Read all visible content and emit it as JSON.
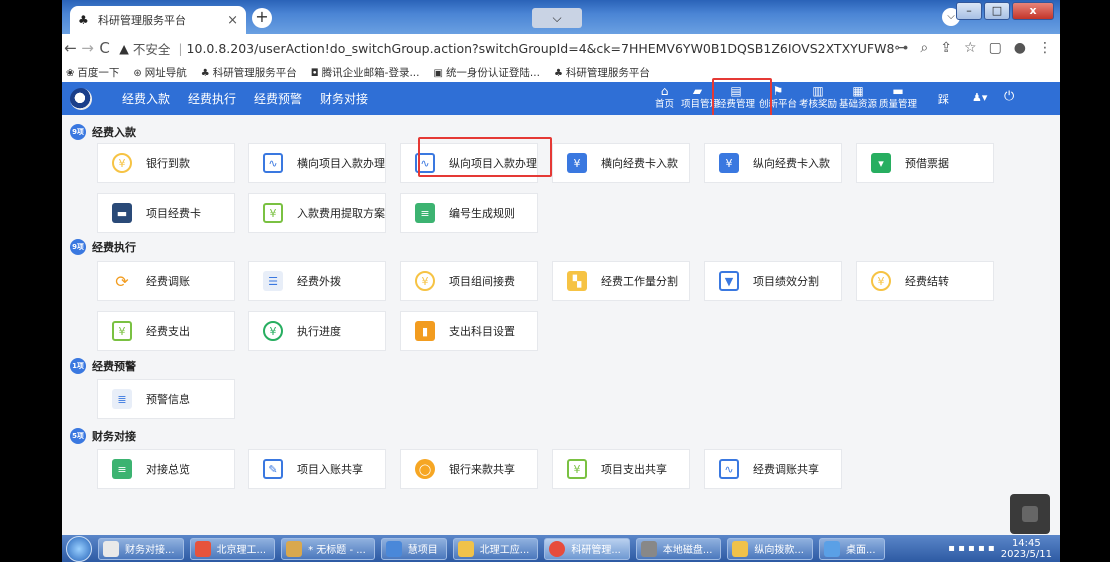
{
  "browser": {
    "tab_title": "科研管理服务平台",
    "tab_close": "×",
    "new_tab": "+",
    "tab_dropdown": "⌵",
    "address": {
      "insecure_label": "不安全",
      "url": "10.0.8.203/userAction!do_switchGroup.action?switchGroupId=4&ck=7HHEMV6YW0B1DQSB1Z6IOVS2XTXYUFW8"
    }
  },
  "bookmarks": [
    "百度一下",
    "网址导航",
    "科研管理服务平台",
    "腾讯企业邮箱-登录...",
    "统一身份认证登陆...",
    "科研管理服务平台"
  ],
  "appnav": {
    "left_menu": [
      "经费入款",
      "经费执行",
      "经费预警",
      "财务对接"
    ],
    "right_menu": [
      {
        "label": "首页",
        "icon": "home-icon"
      },
      {
        "label": "项目管理",
        "icon": "folder-icon"
      },
      {
        "label": "经费管理",
        "icon": "ledger-icon"
      },
      {
        "label": "创新平台",
        "icon": "flag-icon"
      },
      {
        "label": "考核奖励",
        "icon": "chart-icon"
      },
      {
        "label": "基础资源",
        "icon": "grid-icon"
      },
      {
        "label": "质量管理",
        "icon": "doc-icon"
      }
    ],
    "user_menu": "踩",
    "person_menu": "▾"
  },
  "sections": [
    {
      "badge": "9项",
      "title": "经费入款"
    },
    {
      "badge": "9项",
      "title": "经费执行"
    },
    {
      "badge": "1项",
      "title": "经费预警"
    },
    {
      "badge": "5项",
      "title": "财务对接"
    }
  ],
  "cards": {
    "income": [
      "银行到款",
      "横向项目入款办理",
      "纵向项目入款办理",
      "横向经费卡入款",
      "纵向经费卡入款",
      "预借票据",
      "项目经费卡",
      "入款费用提取方案",
      "编号生成规则"
    ],
    "execution": [
      "经费调账",
      "经费外拨",
      "项目组间接费",
      "经费工作量分割",
      "项目绩效分割",
      "经费结转",
      "经费支出",
      "执行进度",
      "支出科目设置"
    ],
    "warning": [
      "预警信息"
    ],
    "finance": [
      "对接总览",
      "项目入账共享",
      "银行来款共享",
      "项目支出共享",
      "经费调账共享"
    ]
  },
  "taskbar": {
    "items": [
      "财务对接...",
      "北京理工...",
      "* 无标题 - ...",
      "慧项目",
      "北理工应...",
      "科研管理...",
      "本地磁盘...",
      "纵向拨款...",
      "桌面..."
    ],
    "time": "14:45",
    "date": "2023/5/11"
  }
}
